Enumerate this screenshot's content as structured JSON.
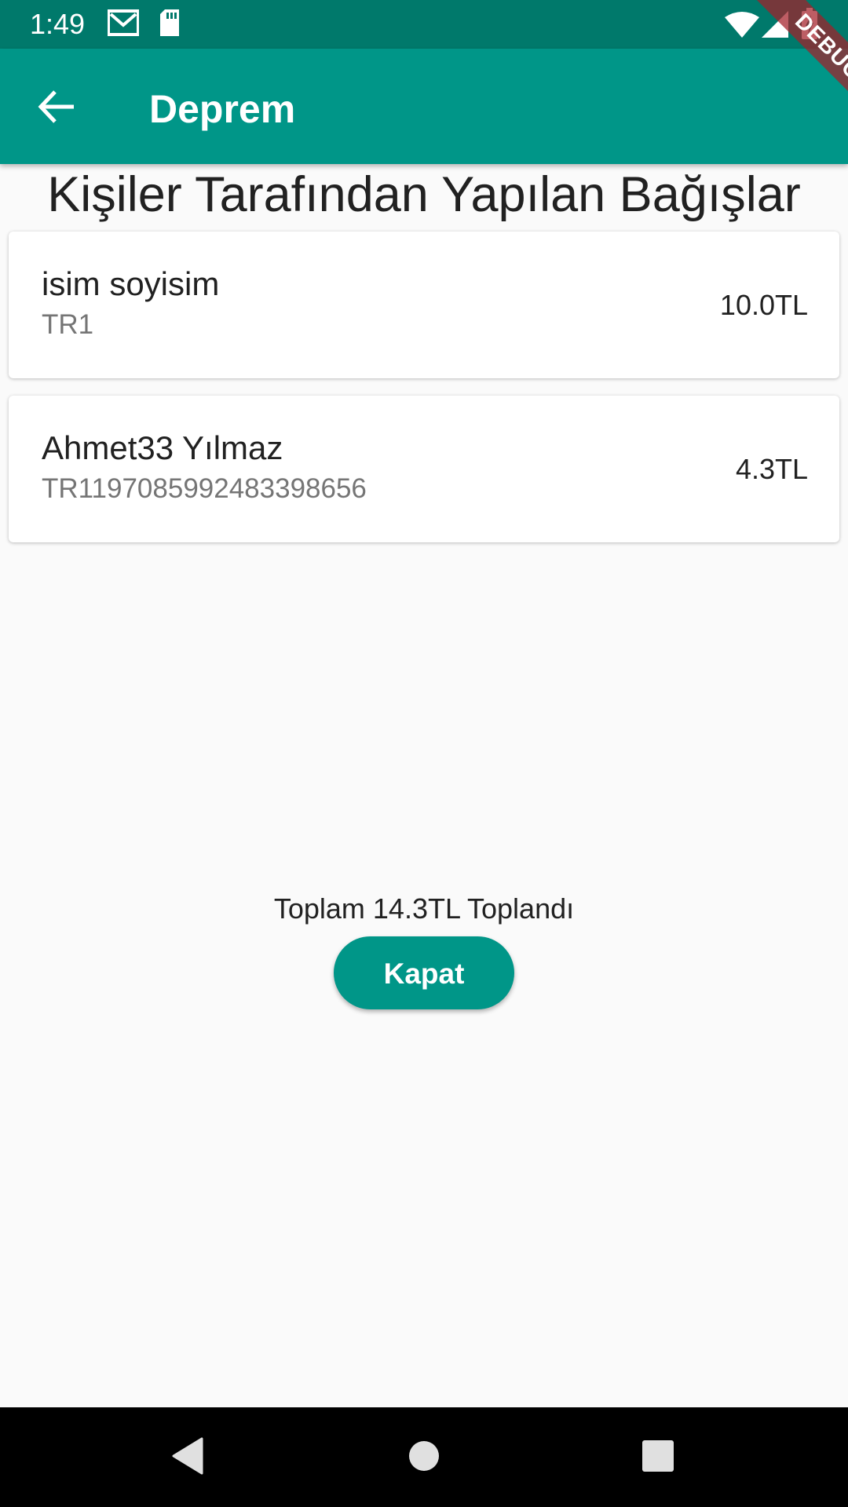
{
  "status_bar": {
    "time": "1:49",
    "icons": [
      "gmail-icon",
      "sd-card-icon",
      "wifi-icon",
      "signal-icon",
      "battery-charging-icon"
    ]
  },
  "app_bar": {
    "title": "Deprem",
    "back_icon": "arrow-back-icon"
  },
  "debug_banner": "DEBUG",
  "page": {
    "heading": "Kişiler Tarafından Yapılan Bağışlar"
  },
  "donations": [
    {
      "name": "isim soyisim",
      "iban": "TR1",
      "amount": "10.0TL"
    },
    {
      "name": "Ahmet33 Yılmaz",
      "iban": "TR1197085992483398656",
      "amount": "4.3TL"
    }
  ],
  "summary": {
    "total_text": "Toplam 14.3TL Toplandı",
    "close_label": "Kapat"
  },
  "nav_bar": {
    "icons": [
      "back-triangle-icon",
      "home-circle-icon",
      "recents-square-icon"
    ]
  },
  "colors": {
    "primary": "#009688",
    "primary_dark": "#00796b",
    "background": "#fafafa"
  }
}
